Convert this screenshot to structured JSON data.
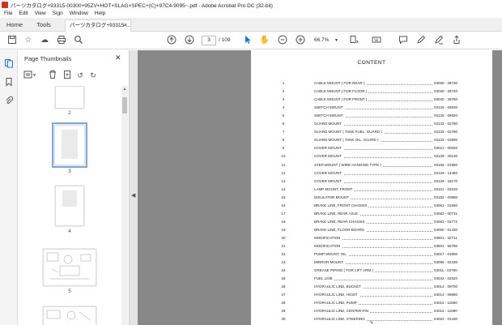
{
  "window": {
    "title": "パーツカタログ+93315-00300+95ZV+HOT+SLAG+SPEC+(C)+97C4-9095~.pdf - Adobe Acrobat Pro DC (32-bit)"
  },
  "menu": [
    "File",
    "Edit",
    "View",
    "Sign",
    "Window",
    "Help"
  ],
  "tabs": {
    "home": "Home",
    "tools": "Tools",
    "document": "パーツカタログ+93315-..."
  },
  "toolbar": {
    "current_page": "3",
    "total_pages": "/ 109",
    "zoom": "66.7%"
  },
  "panel": {
    "title": "Page Thumbnails",
    "thumbnail_labels": [
      "2",
      "3",
      "4",
      "5"
    ]
  },
  "document": {
    "heading": "CONTENT",
    "entries": [
      {
        "n": "1",
        "t": "CABLE MOUNT ( FOR REAR )",
        "c": "03030 - 28730"
      },
      {
        "n": "2",
        "t": "CABLE MOUNT ( FOR FLOOR )",
        "c": "03030 - 28740"
      },
      {
        "n": "3",
        "t": "CABLE MOUNT ( FOR FRONT )",
        "c": "03030 - 28760"
      },
      {
        "n": "4",
        "t": "SWITCH MOUNT",
        "c": "03126 - 06930"
      },
      {
        "n": "5",
        "t": "SWITCH MOUNT",
        "c": "03126 - 06920"
      },
      {
        "n": "6",
        "t": "GUARD MOUNT",
        "c": "03133 - 02780"
      },
      {
        "n": "7",
        "t": "GUARD MOUNT ( TANK FUEL, GUARD )",
        "c": "03133 - 02790"
      },
      {
        "n": "8",
        "t": "GUARD MOUNT ( TANK OIL, GUARD )",
        "c": "03133 - 02800"
      },
      {
        "n": "9",
        "t": "COVER MOUNT",
        "c": "03021 - 00020"
      },
      {
        "n": "10",
        "t": "COVER MOUNT",
        "c": "03129 - 20130"
      },
      {
        "n": "11",
        "t": "STEP MOUNT ( WIRE HANGING TYPE )",
        "c": "03165 - 01950"
      },
      {
        "n": "12",
        "t": "COVER MOUNT",
        "c": "03129 - 14460"
      },
      {
        "n": "13",
        "t": "COVER MOUNT",
        "c": "03129 - 18170"
      },
      {
        "n": "14",
        "t": "LAMP MOUNT, FRONT",
        "c": "03101 - 03220"
      },
      {
        "n": "15",
        "t": "INSULATOR MOUNT",
        "c": "03152 - 00950"
      },
      {
        "n": "16",
        "t": "BRAKE LINE, FRONT CHASSIS",
        "c": "04051 - 01650"
      },
      {
        "n": "17",
        "t": "BRAKE LINE, REAR AXLE",
        "c": "04052 - 00731"
      },
      {
        "n": "18",
        "t": "BRAKE LINE, REAR CHASSIS",
        "c": "04063 - 02772"
      },
      {
        "n": "19",
        "t": "BRAKE LINE, FLOOR BOARD",
        "c": "04050 - 01430"
      },
      {
        "n": "20",
        "t": "MODIFICATION",
        "c": "03501 - 32711"
      },
      {
        "n": "21",
        "t": "MODIFICATION",
        "c": "03501 - 55790"
      },
      {
        "n": "22",
        "t": "PUMP MOUNT, OIL",
        "c": "03017 - 01800"
      },
      {
        "n": "23",
        "t": "MIRROR MOUNT",
        "c": "03096 - 02430"
      },
      {
        "n": "24",
        "t": "GREASE PIPING ( FOR LIFT ARM )",
        "c": "04011 - 02790"
      },
      {
        "n": "25",
        "t": "FUEL LINE",
        "c": "04042 - 02520"
      },
      {
        "n": "26",
        "t": "HYDRAULIC LINE, BUCKET",
        "c": "04014 - 09700"
      },
      {
        "n": "27",
        "t": "HYDRAULIC LINE, HOIST",
        "c": "04014 - 09690"
      },
      {
        "n": "28",
        "t": "HYDRAULIC LINE, PUMP",
        "c": "04014 - 11960"
      },
      {
        "n": "29",
        "t": "HYDRAULIC LINE, CENTER PIN",
        "c": "04014 - 11990"
      },
      {
        "n": "30",
        "t": "HYDRAULIC LINE, STEERING",
        "c": "04022 - 01430"
      }
    ]
  }
}
